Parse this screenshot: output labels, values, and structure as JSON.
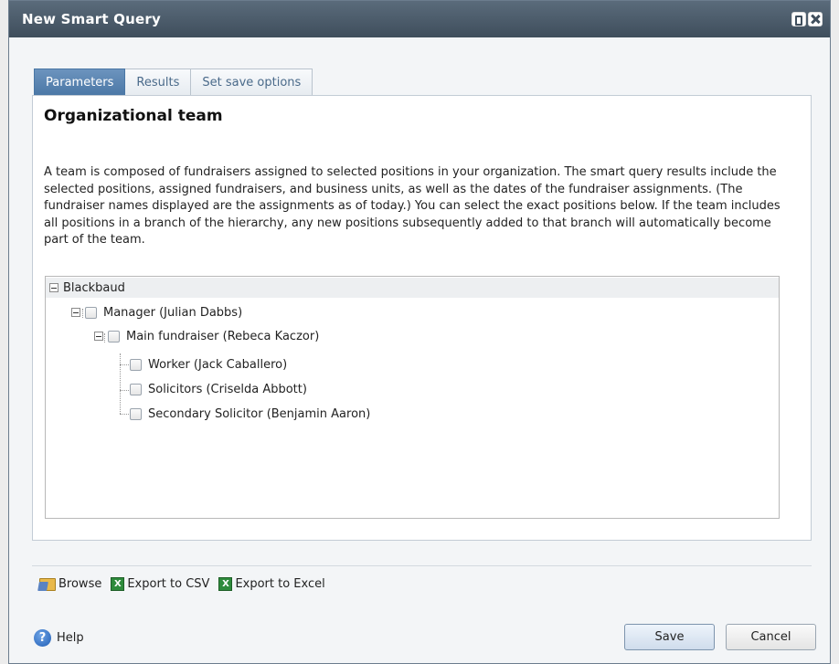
{
  "window": {
    "title": "New Smart Query"
  },
  "tabs": [
    {
      "label": "Parameters",
      "active": true
    },
    {
      "label": "Results",
      "active": false
    },
    {
      "label": "Set save options",
      "active": false
    }
  ],
  "panel": {
    "heading": "Organizational team",
    "description": "A team is composed of fundraisers assigned to selected positions in your organization.  The smart query results include the selected positions, assigned fundraisers, and business units, as well as the dates of the fundraiser assignments. (The fundraiser names displayed are the assignments as of today.) You can select the exact positions below. If the team includes all positions in a branch of the hierarchy, any new positions subsequently added to that branch will automatically become part of the team."
  },
  "tree": {
    "root": "Blackbaud",
    "manager": "Manager (Julian Dabbs)",
    "main_fundraiser": "Main fundraiser (Rebeca Kaczor)",
    "children": [
      "Worker (Jack Caballero)",
      "Solicitors (Criselda Abbott)",
      "Secondary Solicitor (Benjamin Aaron)"
    ]
  },
  "toolbar": {
    "browse": "Browse",
    "export_csv": "Export to CSV",
    "export_excel": "Export to Excel"
  },
  "footer": {
    "help": "Help",
    "save": "Save",
    "cancel": "Cancel"
  },
  "colors": {
    "titlebar": "#4a5a69",
    "active_tab": "#5a86b4",
    "excel_icon": "#2e8b3c"
  }
}
